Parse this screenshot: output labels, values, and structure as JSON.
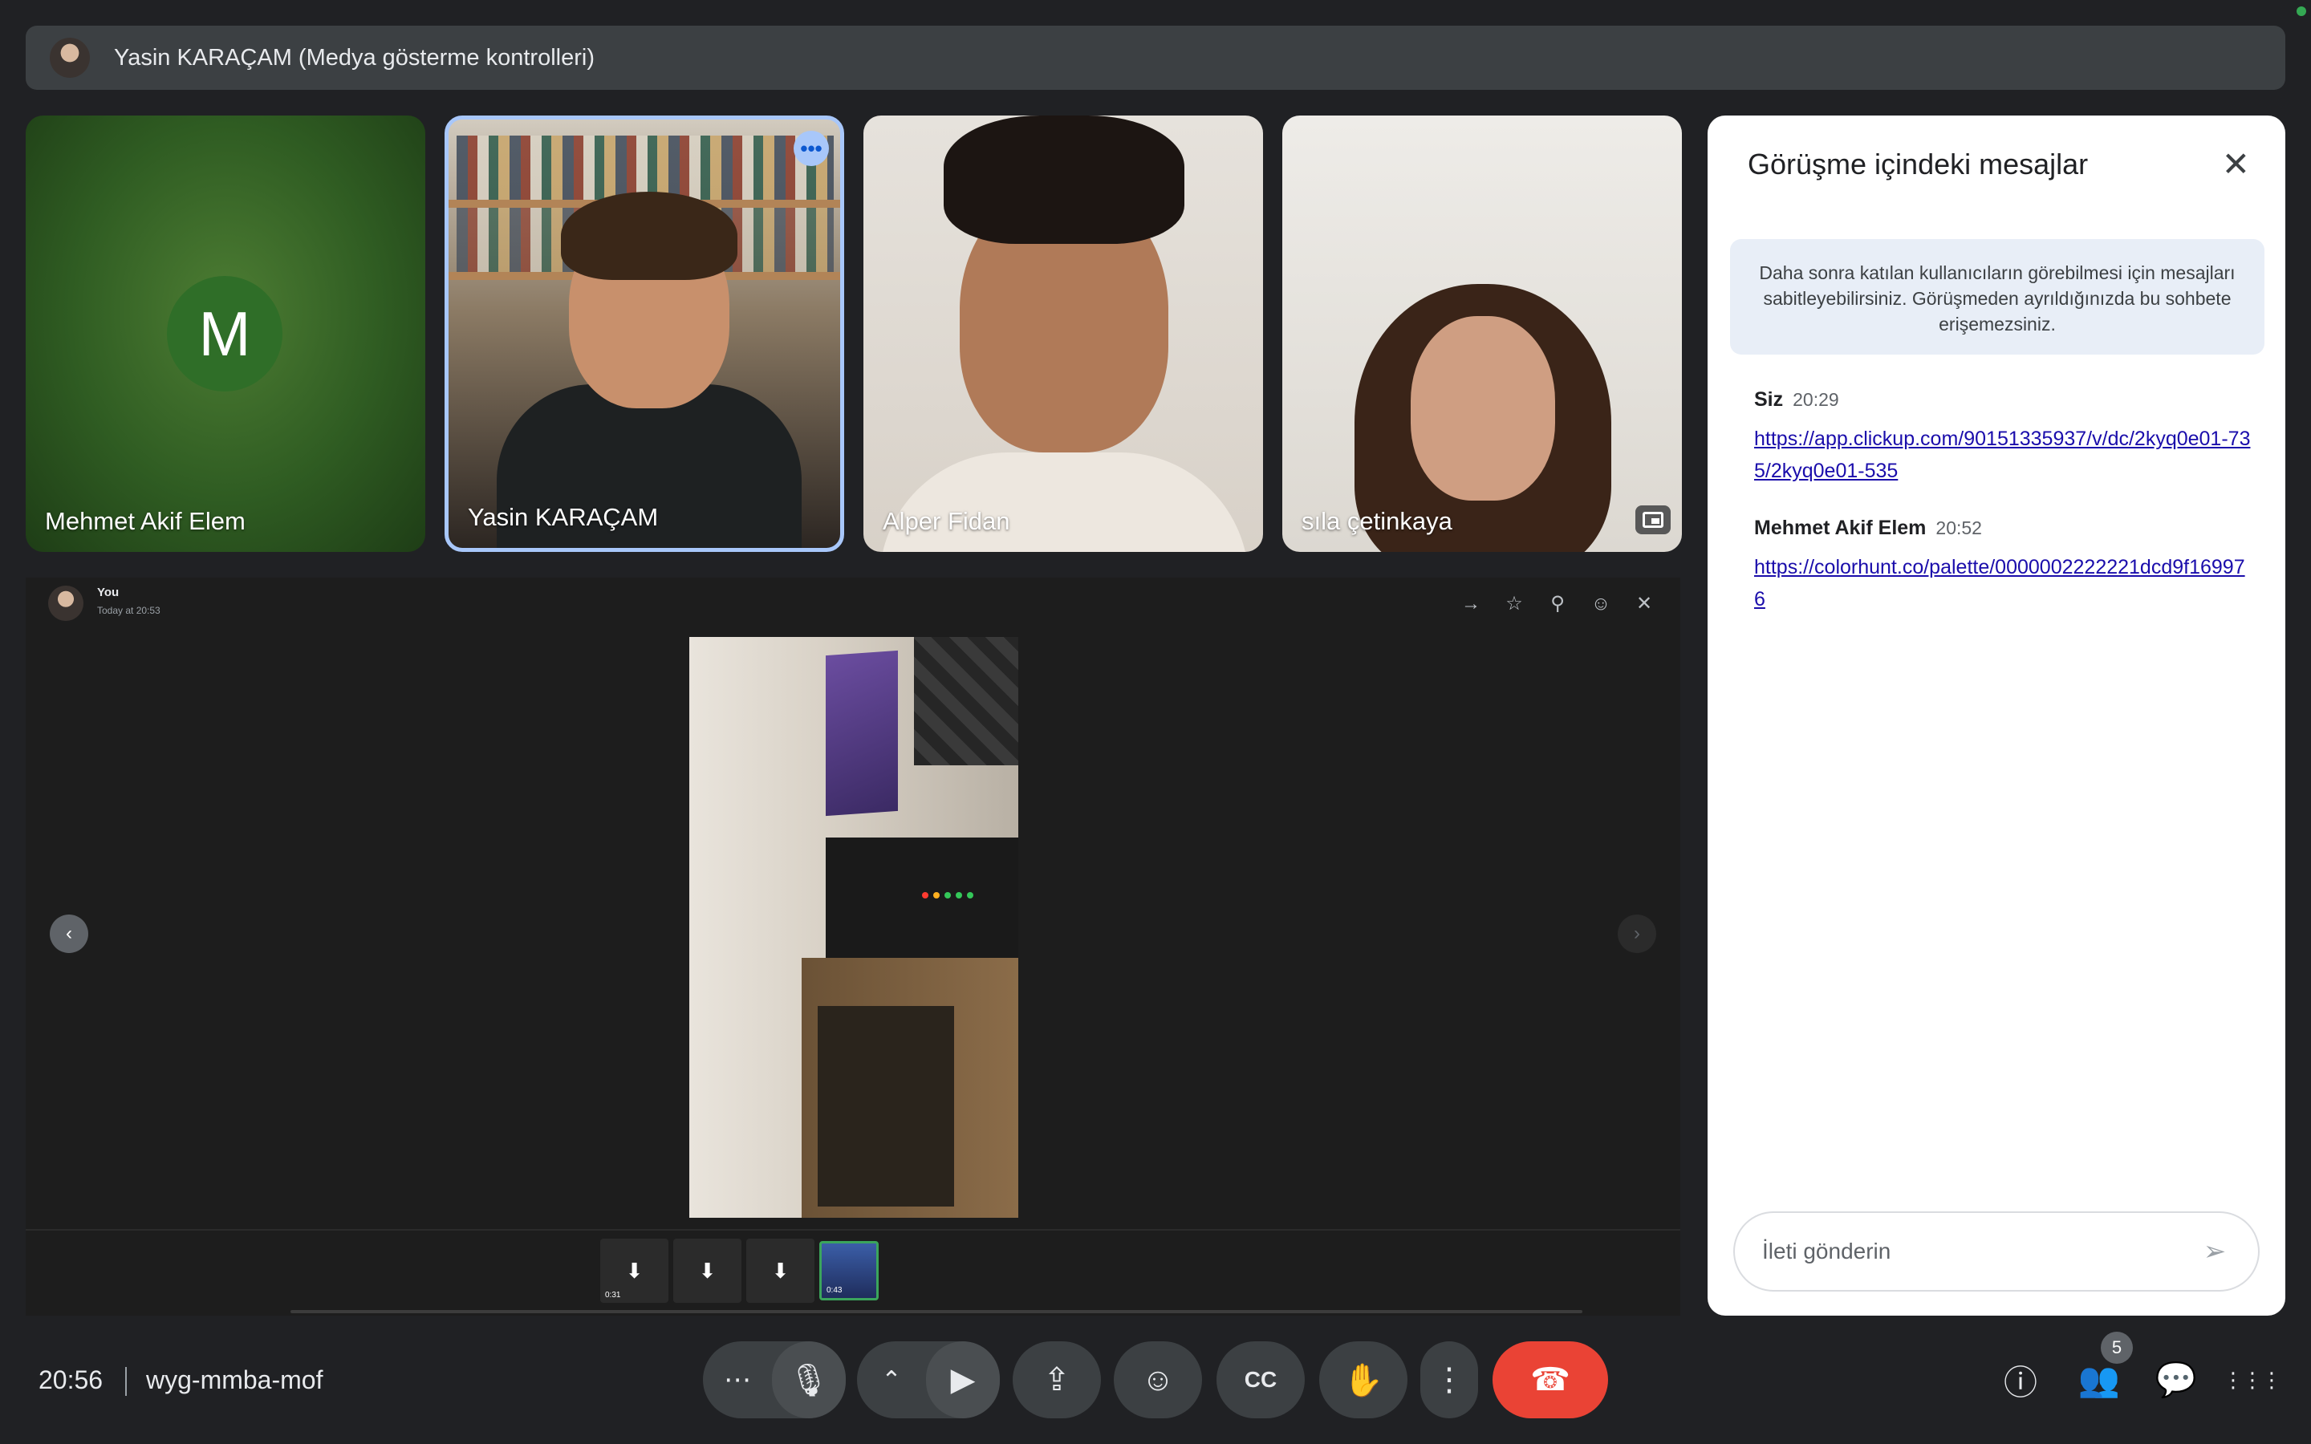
{
  "topbar": {
    "title": "Yasin KARAÇAM (Medya gösterme kontrolleri)"
  },
  "tiles": [
    {
      "name": "Mehmet Akif Elem",
      "avatar_letter": "M"
    },
    {
      "name": "Yasin KARAÇAM",
      "more_icon": "more-horiz-icon"
    },
    {
      "name": "Alper Fidan"
    },
    {
      "name": "sıla çetinkaya",
      "pip_icon": "picture-in-picture-icon"
    }
  ],
  "shared": {
    "author": "You",
    "timestamp": "Today at 20:53",
    "tools": [
      "→",
      "☆",
      "⚲",
      "☺",
      "✕"
    ],
    "prev": "‹",
    "next": "›",
    "thumbs": [
      {
        "icon": "⬇",
        "duration": "0:31"
      },
      {
        "icon": "⬇",
        "duration": ""
      },
      {
        "icon": "⬇",
        "duration": ""
      },
      {
        "icon": "",
        "duration": "0:43"
      }
    ],
    "led_colors": [
      "#ff3b30",
      "#ffb020",
      "#34c759",
      "#34c759",
      "#34c759"
    ]
  },
  "chat": {
    "title": "Görüşme içindeki mesajlar",
    "close": "✕",
    "info": "Daha sonra katılan kullanıcıların görebilmesi için mesajları sabitleyebilirsiniz. Görüşmeden ayrıldığınızda bu sohbete erişemezsiniz.",
    "messages": [
      {
        "sender": "Siz",
        "time": "20:29",
        "link": "https://app.clickup.com/90151335937/v/dc/2kyq0e01-735/2kyq0e01-535"
      },
      {
        "sender": "Mehmet Akif Elem",
        "time": "20:52",
        "link": "https://colorhunt.co/palette/0000002222221dcd9f169976"
      }
    ],
    "input_placeholder": "İleti gönderin",
    "send": "➢"
  },
  "bottom": {
    "clock": "20:56",
    "meeting_code": "wyg-mmba-mof",
    "controls": {
      "more_options": "⋯",
      "mic": "🎙",
      "chevron": "⌃",
      "camera": "▶",
      "present": "⇪",
      "emoji": "☺",
      "captions": "CC",
      "raise_hand": "✋",
      "overflow": "⋮",
      "end_call": "☎"
    },
    "info": "ⓘ",
    "people": "👥",
    "people_count": "5",
    "chat": "💬",
    "activities": "⋮⋮⋮",
    "end_call_color": "#ea4335",
    "tile_highlight_color": "#a8c7fa"
  }
}
